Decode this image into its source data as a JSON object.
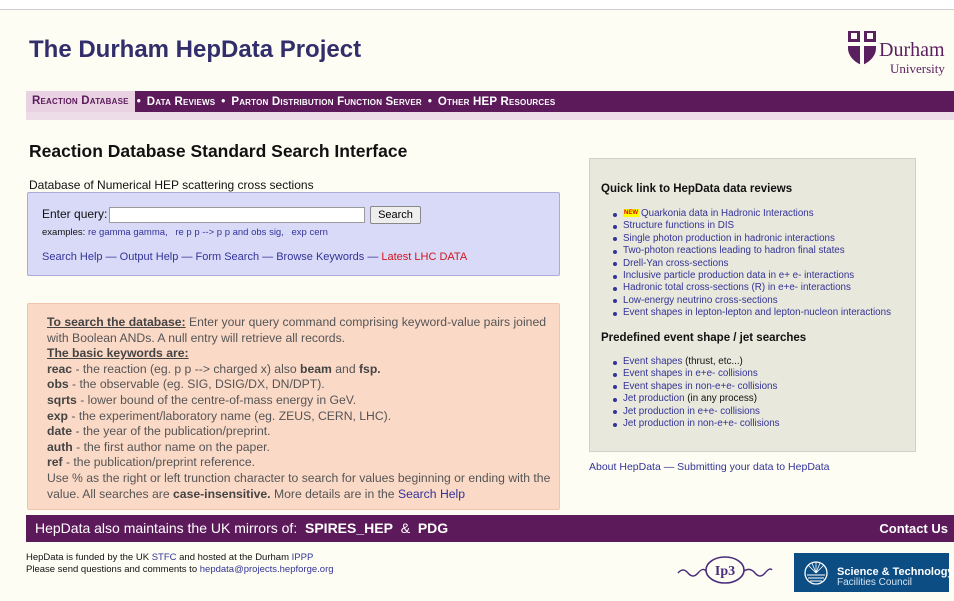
{
  "header": {
    "title": "The Durham HepData Project",
    "logo": {
      "line1": "Durham",
      "line2": "University"
    }
  },
  "nav": {
    "items": [
      {
        "label": "Reaction Database",
        "active": true
      },
      {
        "label": "Data Reviews"
      },
      {
        "label": "Parton Distribution Function Server"
      },
      {
        "label": "Other HEP Resources"
      }
    ],
    "separator": "•"
  },
  "main": {
    "title": "Reaction Database Standard Search Interface",
    "description": "Database of Numerical HEP scattering cross sections",
    "query": {
      "label": "Enter query:",
      "value": "",
      "button": "Search",
      "examples_label": "examples:",
      "examples": [
        "re gamma gamma,",
        "re p p --> p p and obs sig,",
        "exp cern"
      ]
    },
    "help_links": {
      "items": [
        "Search Help",
        "Output Help",
        "Form Search",
        "Browse Keywords"
      ],
      "separator": "—",
      "highlight": "Latest LHC DATA",
      "highlight_color": "#d0161e"
    }
  },
  "help": {
    "intro_label": "To search the database:",
    "intro_text": " Enter your query command comprising keyword-value pairs joined with Boolean ANDs. A null entry will retrieve all records.",
    "keywords_label": "The basic keywords are:",
    "reac_key": "reac",
    "reac_text": " - the reaction (eg. p p --> charged x) also ",
    "reac_beam": "beam",
    "reac_and": " and ",
    "reac_fsp": "fsp.",
    "obs_key": "obs",
    "obs_text": " - the observable (eg. SIG, DSIG/DX, DN/DPT).",
    "sqrts_key": "sqrts",
    "sqrts_text": " - lower bound of the centre-of-mass energy in GeV.",
    "exp_key": "exp",
    "exp_text": " - the experiment/laboratory name (eg. ZEUS, CERN, LHC).",
    "date_key": "date",
    "date_text": " - the year of the publication/preprint.",
    "auth_key": "auth",
    "auth_text": " - the first author name on the paper.",
    "ref_key": "ref",
    "ref_text": " - the publication/preprint reference.",
    "wildcard_text": "Use % as the right or left trunction character to search for values beginning or ending with the value. All searches are ",
    "case_label": "case-insensitive.",
    "more_text": " More details are in the ",
    "search_help_link": "Search Help"
  },
  "sidebar": {
    "reviews_title": "Quick link to HepData data reviews",
    "new_badge": "NEW",
    "reviews": [
      "Quarkonia data in Hadronic Interactions",
      "Structure functions in DIS",
      "Single photon production in hadronic interactions",
      "Two-photon reactions leading to hadron final states",
      "Drell-Yan cross-sections",
      "Inclusive particle production data in e+ e- interactions",
      "Hadronic total cross-sections (R) in e+e- interactions",
      "Low-energy neutrino cross-sections",
      "Event shapes in lepton-lepton and lepton-nucleon interactions"
    ],
    "searches_title": "Predefined event shape / jet searches",
    "searches": [
      {
        "link": "Event shapes",
        "suffix": " (thrust, etc...)"
      },
      {
        "link": "Event shapes in e+e- collisions",
        "suffix": ""
      },
      {
        "link": "Event shapes in non-e+e- collisions",
        "suffix": ""
      },
      {
        "link": "Jet production",
        "suffix": " (in any process)"
      },
      {
        "link": "Jet production in e+e- collisions",
        "suffix": ""
      },
      {
        "link": "Jet production in non-e+e- collisions",
        "suffix": ""
      }
    ],
    "about_link": "About HepData",
    "about_sep": "—",
    "submit_link": "Submitting your data to HepData"
  },
  "footer": {
    "mirror_text": "HepData also maintains the UK mirrors of:",
    "spires": "SPIRES_HEP",
    "amp": "&",
    "pdg": "PDG",
    "contact": "Contact Us",
    "funded_prefix": "HepData is funded by the UK ",
    "stfc_link": "STFC",
    "funded_mid": " and hosted at the Durham ",
    "ippp_link": "IPPP",
    "contact_prefix": "Please send questions and comments to ",
    "email": "hepdata@projects.hepforge.org",
    "ip3_logo": "Ip3",
    "stfc_line1": "Science & Technology",
    "stfc_line2": "Facilities Council"
  }
}
